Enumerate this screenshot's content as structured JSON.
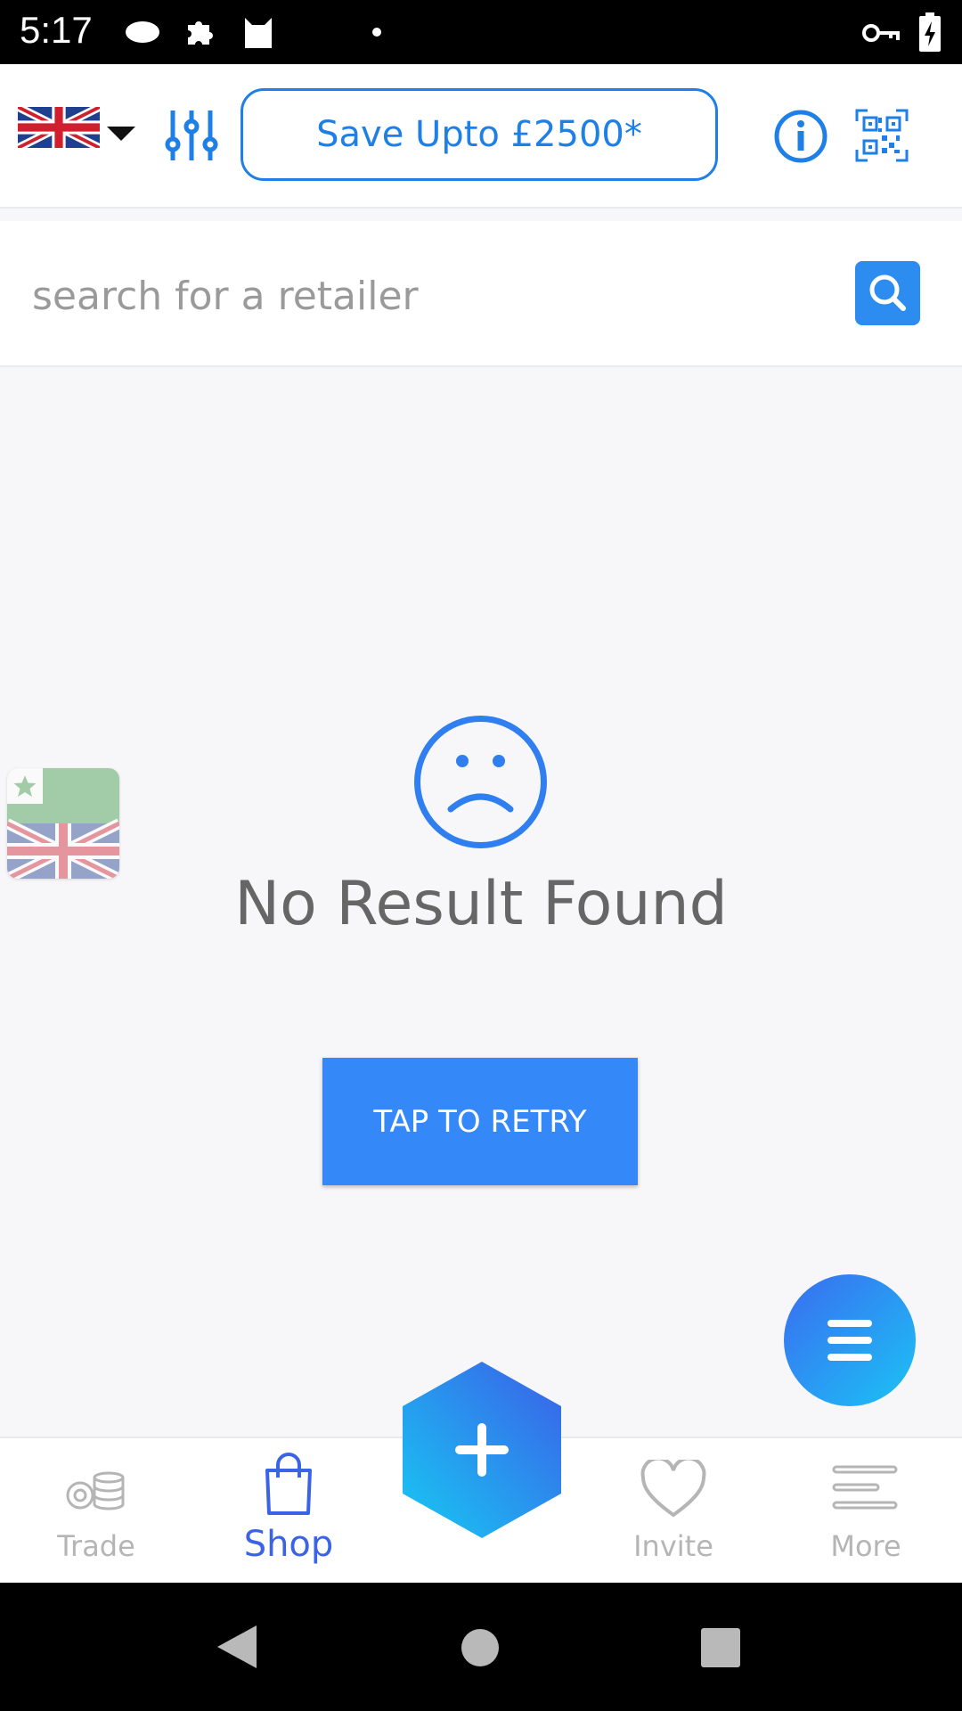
{
  "status_bar": {
    "time": "5:17"
  },
  "header": {
    "save_label": "Save Upto £2500*"
  },
  "search": {
    "placeholder": "search for a retailer"
  },
  "empty_state": {
    "message": "No Result Found",
    "retry_label": "TAP TO RETRY"
  },
  "bottom_nav": {
    "items": [
      {
        "label": "Trade"
      },
      {
        "label": "Shop"
      },
      {
        "label": "Invite"
      },
      {
        "label": "More"
      }
    ]
  },
  "colors": {
    "accent": "#1e7fe6",
    "retry": "#3488f8",
    "active_nav": "#3b63e6"
  }
}
